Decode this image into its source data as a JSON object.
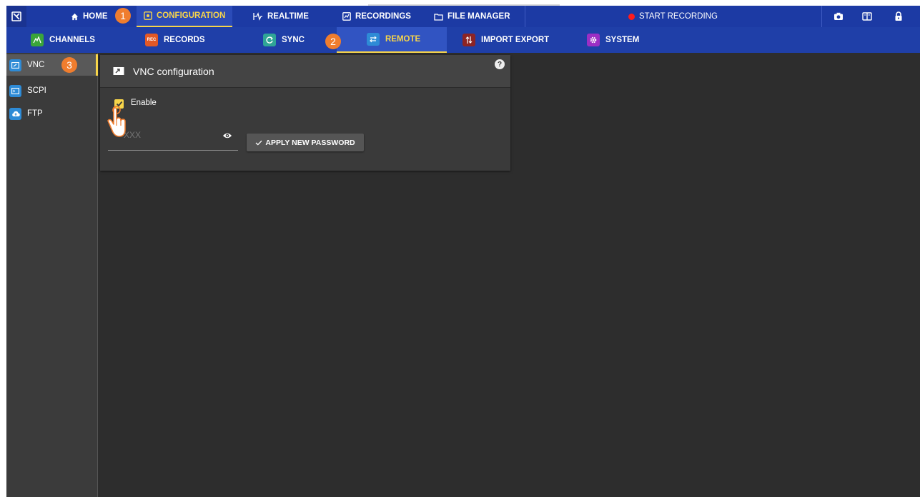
{
  "topbar": {
    "home": "HOME",
    "configuration": "CONFIGURATION",
    "realtime": "REALTIME",
    "recordings": "RECORDINGS",
    "file_manager": "FILE MANAGER",
    "start_recording": "START RECORDING"
  },
  "subbar": {
    "channels": "CHANNELS",
    "records": "RECORDS",
    "sync": "SYNC",
    "remote": "REMOTE",
    "import_export": "IMPORT EXPORT",
    "system": "SYSTEM"
  },
  "leftnav": {
    "items": [
      {
        "label": "VNC"
      },
      {
        "label": "SCPI"
      },
      {
        "label": "FTP"
      }
    ]
  },
  "panel": {
    "title": "VNC configuration",
    "enable_label": "Enable",
    "enable_checked": true,
    "password_placeholder": "XXX",
    "apply_label": "APPLY NEW PASSWORD"
  },
  "markers": {
    "one": "1",
    "two": "2",
    "three": "3"
  },
  "colors": {
    "accent": "#f7d54a",
    "topbar": "#1c3aa4",
    "marker": "#ef7d2e",
    "record": "#ff1b1b"
  }
}
